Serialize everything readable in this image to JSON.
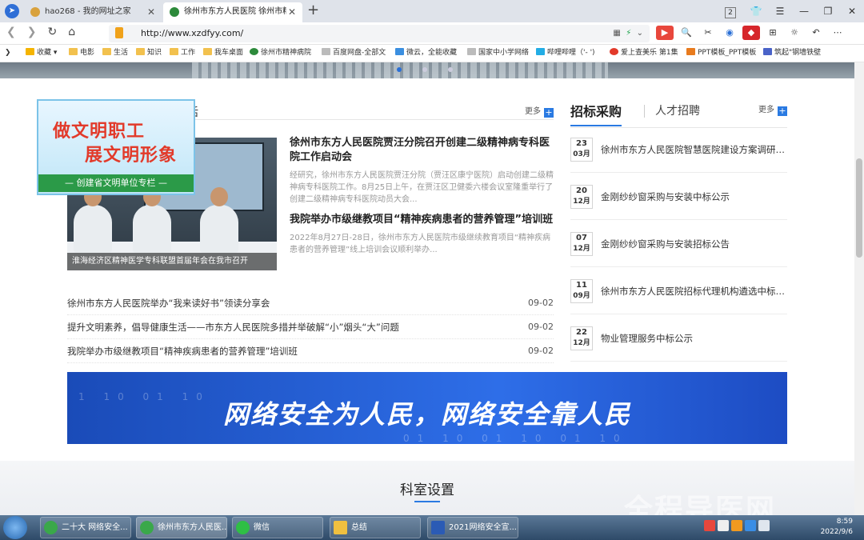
{
  "browser": {
    "tabs": [
      {
        "title": "hao268 - 我的网址之家"
      },
      {
        "title": "徐州市东方人民医院 徐州市精神"
      }
    ],
    "tab_count": "2",
    "url": "http://www.xzdfyy.com/",
    "bookmarks": [
      "收藏",
      "电影",
      "生活",
      "知识",
      "工作",
      "我车桌面",
      "徐州市精神病院",
      "百度网盘-全部文",
      "微云，全能收藏",
      "国家中小学网络",
      "哔哩哔哩（'- ')",
      "爱上查美乐 第1集",
      "PPT模板_PPT模板",
      "筑起\"钢墙铁壁"
    ]
  },
  "page": {
    "news": {
      "title_fragment": "活",
      "more_label": "更多",
      "photo_caption": "淮海经济区精神医学专科联盟首届年会在我市召开",
      "articles": [
        {
          "title": "徐州市东方人民医院贾汪分院召开创建二级精神病专科医院工作启动会",
          "summary": "经研究，徐州市东方人民医院贾汪分院（贾汪区康宁医院）启动创建二级精神病专科医院工作。8月25日上午，在贾汪区卫健委六楼会议室隆重举行了创建二级精神病专科医院动员大会..."
        },
        {
          "title": "我院举办市级继教项目“精神疾病患者的营养管理”培训班",
          "summary": "2022年8月27日-28日，徐州市东方人民医院市级继续教育项目“精神疾病患者的营养管理”线上培训会议顺利举办..."
        }
      ],
      "list": [
        {
          "title": "徐州市东方人民医院举办“我来读好书”领读分享会",
          "date": "09-02"
        },
        {
          "title": "提升文明素养，倡导健康生活——市东方人民医院多措并举破解“小”烟头“大”问题",
          "date": "09-02"
        },
        {
          "title": "我院举办市级继教项目“精神疾病患者的营养管理”培训班",
          "date": "09-02"
        }
      ]
    },
    "badge": {
      "line1": "做文明职工",
      "line2": "展文明形象",
      "line3": "— 创建省文明单位专栏 —"
    },
    "side": {
      "tab_active": "招标采购",
      "tab_inactive": "人才招聘",
      "more_label": "更多",
      "notices": [
        {
          "day": "23",
          "month": "03月",
          "title": "徐州市东方人民医院智慧医院建设方案调研公告"
        },
        {
          "day": "20",
          "month": "12月",
          "title": "金刚纱纱窗采购与安装中标公示"
        },
        {
          "day": "07",
          "month": "12月",
          "title": "金刚纱纱窗采购与安装招标公告"
        },
        {
          "day": "11",
          "month": "09月",
          "title": "徐州市东方人民医院招标代理机构遴选中标公示"
        },
        {
          "day": "22",
          "month": "12月",
          "title": "物业管理服务中标公示"
        }
      ]
    },
    "promo": {
      "slogan": "网络安全为人民，网络安全靠人民",
      "bits": "1 10 01 10",
      "bits2": "01 10 01 10 01 10"
    },
    "dept_title": "科室设置"
  },
  "taskbar": {
    "tasks": [
      "二十大 网络安全...",
      "徐州市东方人民医...",
      "微信",
      "总结",
      "2021网络安全宣..."
    ],
    "time": "8:59",
    "date": "2022/9/6"
  },
  "watermark": "全程导医网",
  "colors": {
    "accent": "#2a7ae2",
    "badge_red": "#e23a2a",
    "badge_green": "#2b9a48",
    "promo_blue": "#1a4bb8"
  }
}
